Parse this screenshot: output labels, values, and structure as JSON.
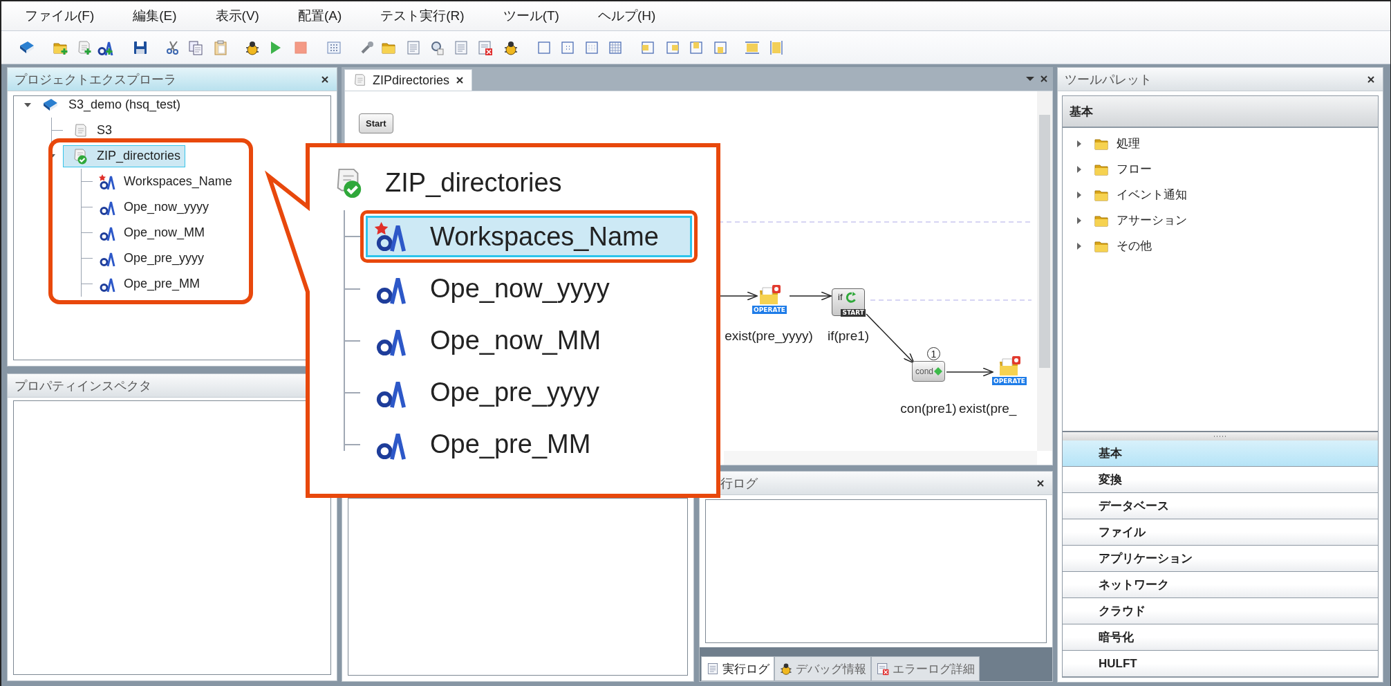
{
  "menu": [
    "ファイル(F)",
    "編集(E)",
    "表示(V)",
    "配置(A)",
    "テスト実行(R)",
    "ツール(T)",
    "ヘルプ(H)"
  ],
  "explorer": {
    "title": "プロジェクトエクスプローラ",
    "tree": [
      {
        "label": "S3_demo (hsq_test)",
        "kind": "project",
        "expanded": true,
        "selected": false,
        "children": [
          {
            "label": "S3",
            "kind": "script",
            "selected": false
          },
          {
            "label": "ZIP_directories",
            "kind": "script-checked",
            "expanded": true,
            "selected": true,
            "children": [
              {
                "label": "Workspaces_Name",
                "kind": "workspace-variable",
                "selected": false
              },
              {
                "label": "Ope_now_yyyy",
                "kind": "variable",
                "selected": false
              },
              {
                "label": "Ope_now_MM",
                "kind": "variable",
                "selected": false
              },
              {
                "label": "Ope_pre_yyyy",
                "kind": "variable",
                "selected": false
              },
              {
                "label": "Ope_pre_MM",
                "kind": "variable",
                "selected": false
              }
            ]
          }
        ]
      }
    ]
  },
  "properties": {
    "title": "プロパティインスペクタ"
  },
  "editor": {
    "tabs": [
      {
        "label": "ZIPdirectories",
        "selected": true
      }
    ],
    "nodes": [
      {
        "kind": "start",
        "icon_text": "Start"
      },
      {
        "kind": "operate",
        "tag": "OPERATE",
        "label": "exist(pre_yyyy)"
      },
      {
        "kind": "if",
        "icon_text": "if",
        "tag": "START",
        "label": "if(pre1)"
      },
      {
        "kind": "cond",
        "icon_text": "cond",
        "badge": "1",
        "label": "con(pre1)"
      },
      {
        "kind": "operate",
        "tag": "OPERATE",
        "label": "exist(pre_"
      }
    ]
  },
  "callout": {
    "title": "ZIP_directories",
    "items": [
      {
        "label": "Workspaces_Name",
        "kind": "workspace-variable",
        "selected": true
      },
      {
        "label": "Ope_now_yyyy",
        "kind": "variable",
        "selected": false
      },
      {
        "label": "Ope_now_MM",
        "kind": "variable",
        "selected": false
      },
      {
        "label": "Ope_pre_yyyy",
        "kind": "variable",
        "selected": false
      },
      {
        "label": "Ope_pre_MM",
        "kind": "variable",
        "selected": false
      }
    ]
  },
  "log": {
    "title": "行ログ",
    "tabs": [
      {
        "label": "実行ログ",
        "kind": "log",
        "selected": true
      },
      {
        "label": "デバッグ情報",
        "kind": "debug",
        "selected": false
      },
      {
        "label": "エラーログ詳細",
        "kind": "error",
        "selected": false
      }
    ]
  },
  "palette": {
    "title": "ツールパレット",
    "section": "基本",
    "folders": [
      {
        "label": "処理",
        "expanded": false
      },
      {
        "label": "フロー",
        "expanded": false
      },
      {
        "label": "イベント通知",
        "expanded": false
      },
      {
        "label": "アサーション",
        "expanded": false
      },
      {
        "label": "その他",
        "expanded": false
      }
    ],
    "categories": [
      {
        "label": "基本",
        "selected": true
      },
      {
        "label": "変換",
        "selected": false
      },
      {
        "label": "データベース",
        "selected": false
      },
      {
        "label": "ファイル",
        "selected": false
      },
      {
        "label": "アプリケーション",
        "selected": false
      },
      {
        "label": "ネットワーク",
        "selected": false
      },
      {
        "label": "クラウド",
        "selected": false
      },
      {
        "label": "暗号化",
        "selected": false
      },
      {
        "label": "HULFT",
        "selected": false
      }
    ]
  }
}
